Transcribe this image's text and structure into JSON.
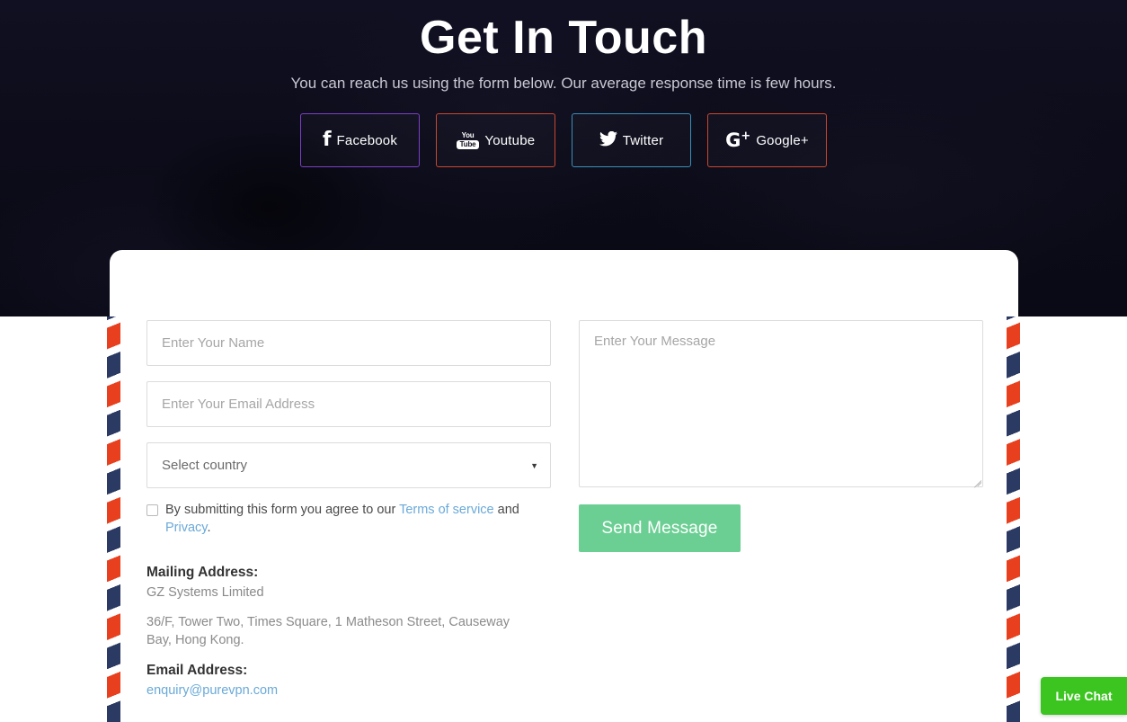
{
  "hero": {
    "title": "Get In Touch",
    "subtitle": "You can reach us using the form below. Our average response time is few hours.",
    "background_color": "#0d0d1a"
  },
  "social_buttons": [
    {
      "label": "Facebook",
      "icon": "facebook-icon",
      "glyph": "f",
      "border_color": "#7b3fc4"
    },
    {
      "label": "Youtube",
      "icon": "youtube-icon",
      "glyph_top": "You",
      "glyph_bottom": "Tube",
      "border_color": "#c9472e"
    },
    {
      "label": "Twitter",
      "icon": "twitter-icon",
      "glyph": "🐦",
      "border_color": "#3a8fb7"
    },
    {
      "label": "Google+",
      "icon": "google-plus-icon",
      "glyph": "G",
      "glyph_sup": "+",
      "border_color": "#c9472e"
    }
  ],
  "form": {
    "name_placeholder": "Enter Your Name",
    "name_value": "",
    "email_placeholder": "Enter Your Email Address",
    "email_value": "",
    "country_selected": "Select country",
    "country_caret": "▼",
    "message_placeholder": "Enter Your Message",
    "message_value": "",
    "send_label": "Send Message",
    "send_color": "#6bcf93",
    "consent": {
      "checked": false,
      "text_before": "By submitting this form you agree to our ",
      "terms_link": "Terms of service",
      "text_between": " and ",
      "privacy_link": "Privacy",
      "text_after": "."
    }
  },
  "contact": {
    "mailing_heading": "Mailing Address:",
    "company": "GZ Systems Limited",
    "address": "36/F, Tower Two, Times Square, 1 Matheson Street, Causeway Bay, Hong Kong.",
    "email_heading": "Email Address:",
    "email": "enquiry@purevpn.com",
    "link_color": "#6aa9d8"
  },
  "live_chat": {
    "label": "Live Chat",
    "color": "#3cc521"
  },
  "decor": {
    "stripe_navy": "#2b3a63",
    "stripe_red": "#e8401f"
  }
}
